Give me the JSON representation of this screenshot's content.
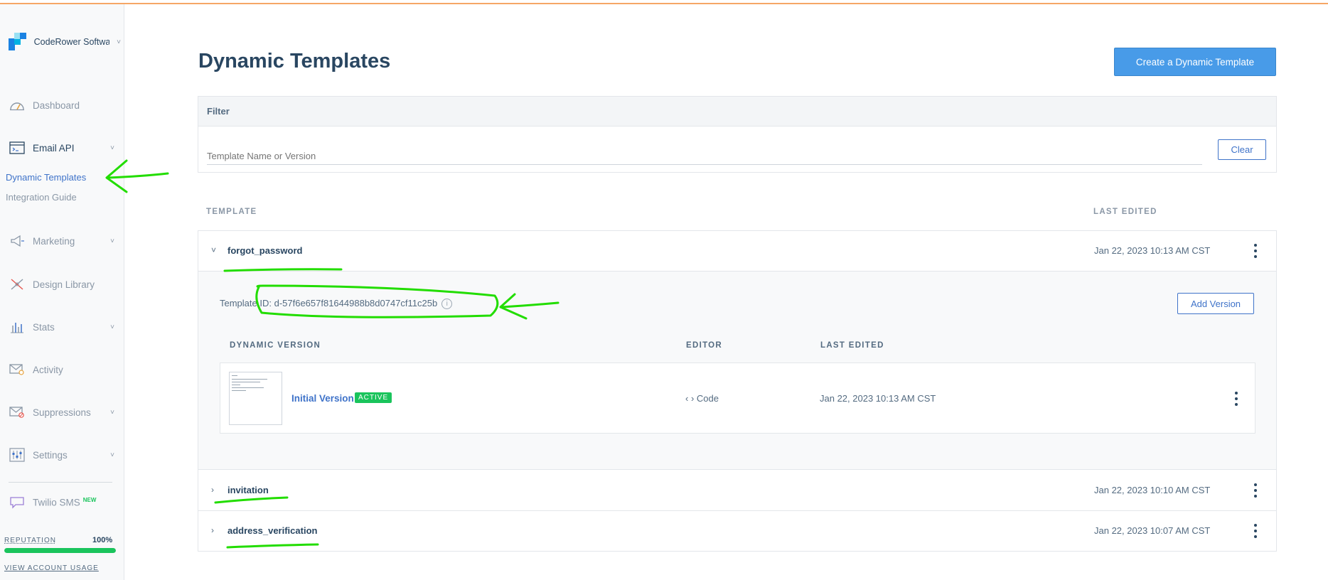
{
  "sidebar": {
    "account_name": "CodeRower Software",
    "nav": [
      {
        "label": "Dashboard",
        "icon": "gauge-icon"
      },
      {
        "label": "Email API",
        "icon": "terminal-icon"
      },
      {
        "label": "Marketing",
        "icon": "megaphone-icon"
      },
      {
        "label": "Design Library",
        "icon": "design-tools-icon"
      },
      {
        "label": "Stats",
        "icon": "bar-chart-icon"
      },
      {
        "label": "Activity",
        "icon": "envelope-search-icon"
      },
      {
        "label": "Suppressions",
        "icon": "envelope-block-icon"
      },
      {
        "label": "Settings",
        "icon": "sliders-icon"
      },
      {
        "label": "Twilio SMS",
        "icon": "chat-bubble-icon",
        "badge": "NEW"
      }
    ],
    "sub_items": [
      "Dynamic Templates",
      "Integration Guide"
    ],
    "reputation": {
      "label": "REPUTATION",
      "value": "100%",
      "fraction": 1.0
    },
    "usage_link": "VIEW ACCOUNT USAGE"
  },
  "page": {
    "title": "Dynamic Templates",
    "create_button": "Create a Dynamic Template"
  },
  "filter": {
    "heading": "Filter",
    "placeholder": "Template Name or Version",
    "clear_button": "Clear"
  },
  "columns": {
    "template": "TEMPLATE",
    "last_edited": "LAST EDITED"
  },
  "templates": [
    {
      "name": "forgot_password",
      "date": "Jan 22, 2023 10:13 AM CST",
      "expanded": true
    },
    {
      "name": "invitation",
      "date": "Jan 22, 2023 10:10 AM CST",
      "expanded": false
    },
    {
      "name": "address_verification",
      "date": "Jan 22, 2023 10:07 AM CST",
      "expanded": false
    }
  ],
  "expanded_template": {
    "template_id": "Template ID: d-57f6e657f81644988b8d0747cf11c25b",
    "add_version_button": "Add Version",
    "version_columns": {
      "version": "DYNAMIC VERSION",
      "editor": "EDITOR",
      "last_edited": "LAST EDITED"
    },
    "versions": [
      {
        "name": "Initial Version",
        "status": "ACTIVE",
        "editor": "‹ › Code",
        "date": "Jan 22, 2023 10:13 AM CST"
      }
    ]
  },
  "colors": {
    "primary": "#489be8",
    "link": "#3f73c9",
    "success": "#1ac45c",
    "annotation": "#22dd00",
    "top_border": "#f6a766"
  }
}
